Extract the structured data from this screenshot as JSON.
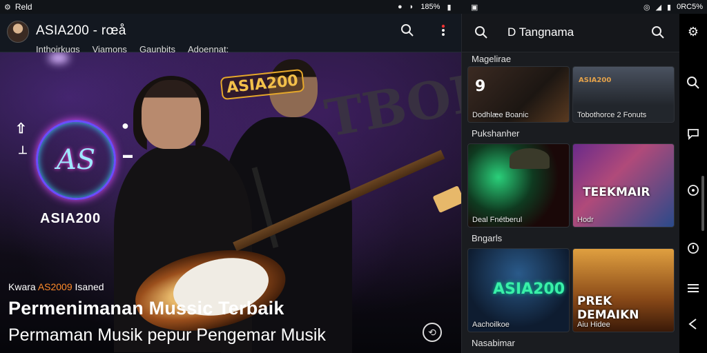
{
  "status_bar": {
    "left_label": "Reld",
    "battery_mid": "185%",
    "right_label": "0RC5%"
  },
  "main_header": {
    "title": "ASIA200 - rœå",
    "nav": [
      "Inthoirkugs",
      "Viamons",
      "Gaunbits",
      "Adoennat:"
    ]
  },
  "hero": {
    "brand_sticker": "ASIA200",
    "bg_text": "TBOIK",
    "logo_monogram": "AS",
    "logo_text": "ASIA200",
    "eyebrow_prefix": "Kwara",
    "eyebrow_highlight": "AS2009",
    "eyebrow_suffix": "Isaned",
    "title": "Permenimanan Mussic Terbaik",
    "subtitle": "Permaman Musik pepur Pengemar Musik"
  },
  "panel": {
    "title": "D Tangnama",
    "sections": [
      {
        "label": "Magelirae",
        "cards": [
          {
            "caption": "Dodhlæe Boanic",
            "badge": "9"
          },
          {
            "caption": "Tobothorce 2 Fonuts",
            "poster": "ASIA200"
          }
        ]
      },
      {
        "label": "Pukshanher",
        "cards": [
          {
            "caption": "Deal Fnétberul"
          },
          {
            "caption": "Hodr",
            "poster": "TEEKMAIR"
          }
        ]
      },
      {
        "label": "Bngarls",
        "cards": [
          {
            "caption": "Aachoilkoe",
            "poster": "ASIA200"
          },
          {
            "caption": "Aiu Hidee",
            "poster": "PREK DEMAIKN"
          }
        ]
      },
      {
        "label": "Nasabimar",
        "cards": []
      }
    ]
  },
  "rail": {
    "items": [
      "gear-icon",
      "search-icon",
      "chat-icon",
      "refresh-icon",
      "info-icon",
      "menu-icon",
      "back-icon"
    ]
  },
  "colors": {
    "accent_orange": "#ff8a2a",
    "logo_purple": "#6b4dff",
    "panel_bg": "#1a1c20",
    "header_bg": "#131820"
  }
}
